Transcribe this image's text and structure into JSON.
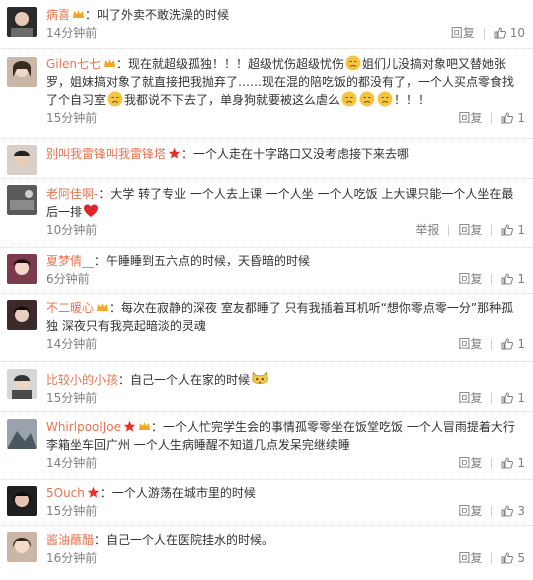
{
  "comments": [
    {
      "name": "病喜",
      "badges": [
        "crown"
      ],
      "text": "叫了外卖不敢洗澡的时候",
      "time": "14分钟前",
      "reply": "回复",
      "likes": "10"
    },
    {
      "name": "Gilen七七",
      "badges": [
        "crown"
      ],
      "text_parts": [
        "现在就超级孤独！！！超级忧伤超级忧伤",
        "姐们儿没搞对象吧又替她张罗，姐妹搞对象了就直接把我抛弃了……现在混的陪吃饭的都没有了，一个人买点零食找了个自习室",
        "我都说不下去了，单身狗就要被这么虐么",
        "！！！"
      ],
      "time": "15分钟前",
      "reply": "回复",
      "likes": "1"
    },
    {
      "name": "别叫我雷锋叫我雷锋塔",
      "badges": [
        "star"
      ],
      "text": "一个人走在十字路口又没考虑接下来去哪",
      "time": "",
      "reply": "",
      "likes": ""
    },
    {
      "name": "老阿佳啊-",
      "badges": [],
      "text": "大学 转了专业 一个人去上课 一个人坐 一个人吃饭 上大课只能一个人坐在最后一排",
      "time": "10分钟前",
      "report": "举报",
      "reply": "回复",
      "likes": "1"
    },
    {
      "name": "夏梦倩__",
      "badges": [],
      "text": "午睡睡到五六点的时候，天昏暗的时候",
      "time": "6分钟前",
      "reply": "回复",
      "likes": "1"
    },
    {
      "name": "不二暖心",
      "badges": [
        "crown"
      ],
      "text": "每次在寂静的深夜 室友都睡了 只有我插着耳机听“想你零点零一分”那种孤独 深夜只有我亮起暗淡的灵魂",
      "time": "14分钟前",
      "reply": "回复",
      "likes": "1"
    },
    {
      "name": "比较小的小孩",
      "badges": [],
      "text": "自己一个人在家的时候",
      "time": "15分钟前",
      "reply": "回复",
      "likes": "1"
    },
    {
      "name": "WhirlpoolJoe",
      "badges": [
        "star",
        "crown"
      ],
      "text": "一个人忙完学生会的事情孤零零坐在饭堂吃饭 一个人冒雨提着大行李箱坐车回广州 一个人生病睡醒不知道几点发呆完继续睡",
      "time": "14分钟前",
      "reply": "回复",
      "likes": "1"
    },
    {
      "name": "5Ouch",
      "badges": [
        "star"
      ],
      "text": "一个人游荡在城市里的时候",
      "time": "15分钟前",
      "reply": "回复",
      "likes": "3"
    },
    {
      "name": "酱油蘸醋",
      "badges": [],
      "text": "自己一个人在医院挂水的时候。",
      "time": "16分钟前",
      "reply": "回复",
      "likes": "5"
    }
  ],
  "colors": {
    "name": "#eb7350",
    "meta": "#808080",
    "badge_crown": "#f6a623",
    "badge_star": "#e8302a"
  }
}
